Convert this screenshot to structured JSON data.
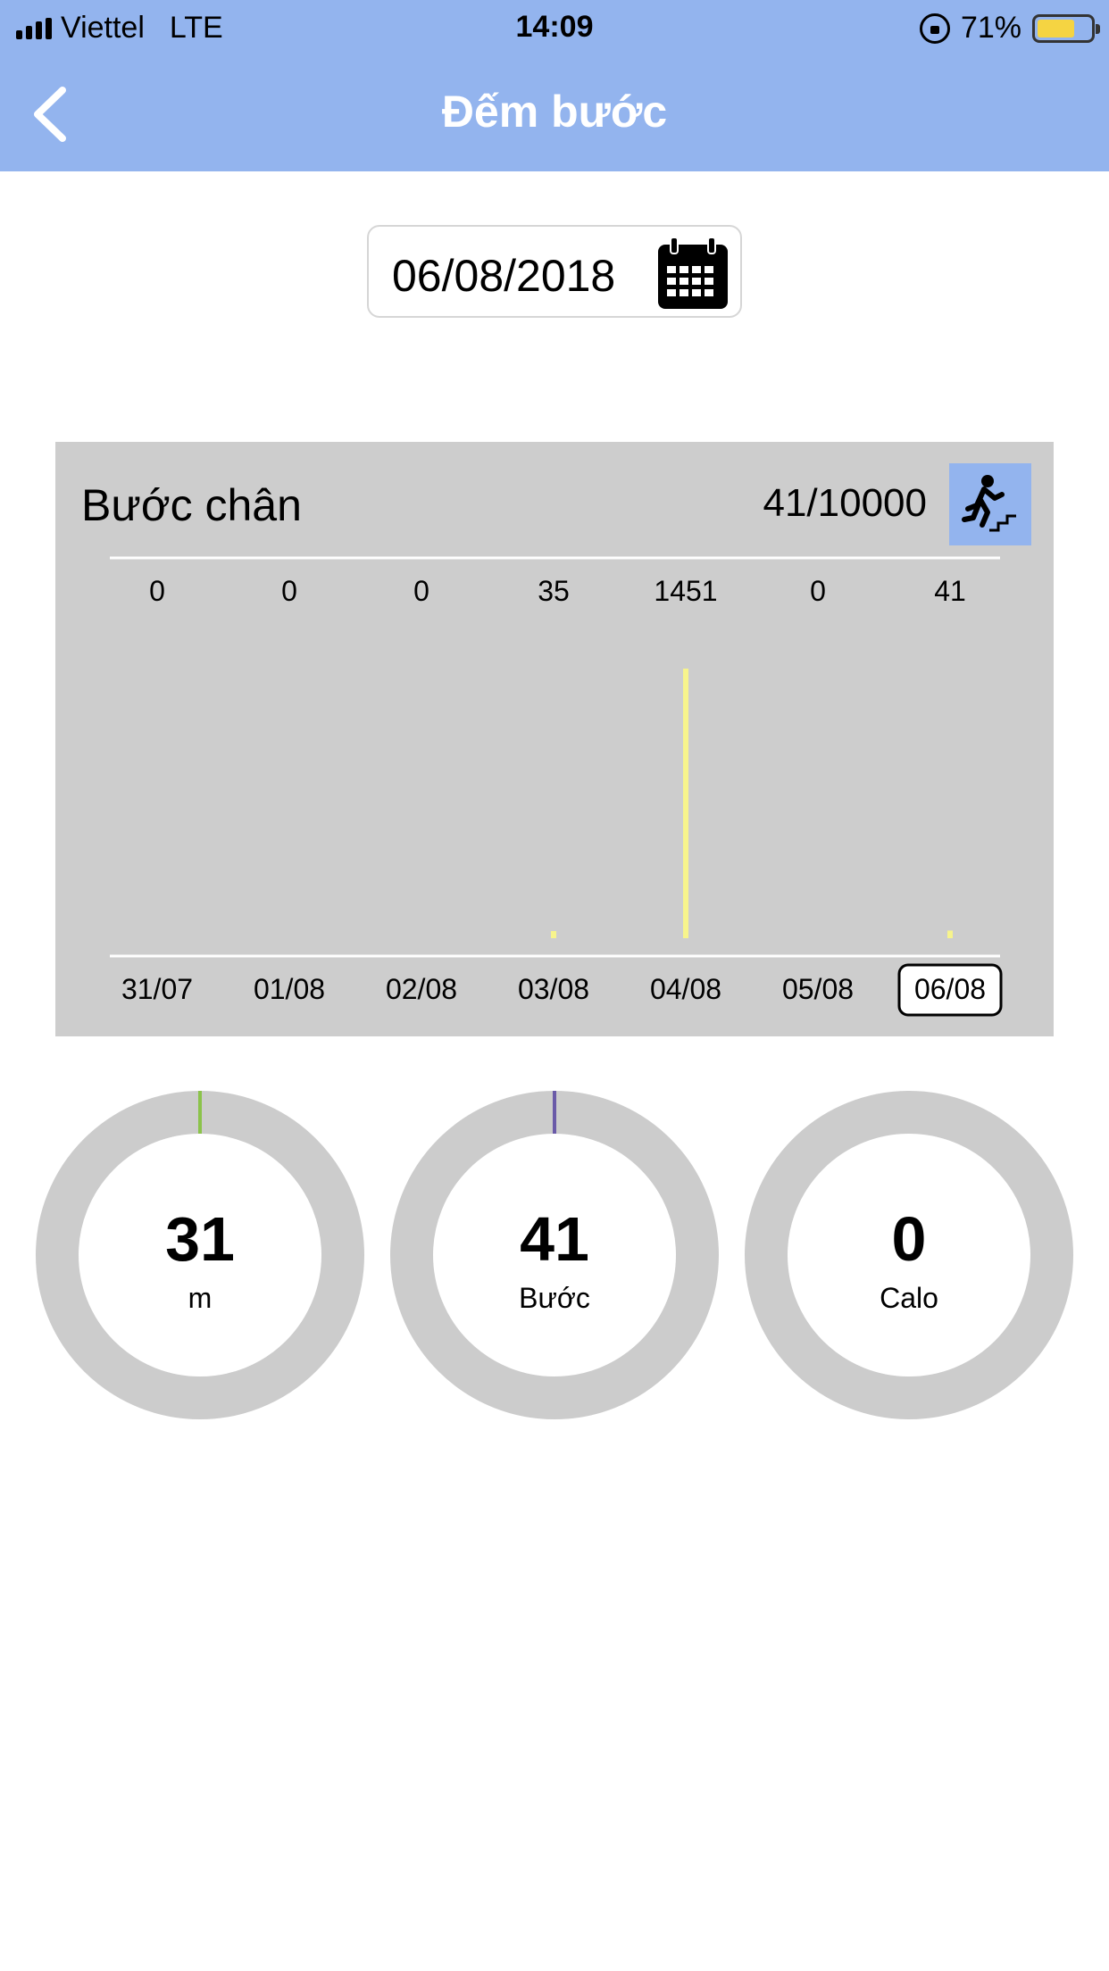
{
  "status_bar": {
    "carrier": "Viettel",
    "network": "LTE",
    "time": "14:09",
    "battery": "71%",
    "battery_level": 0.71
  },
  "header": {
    "title": "Đếm bước",
    "back_icon": "chevron-left-icon"
  },
  "date_picker": {
    "value": "06/08/2018",
    "icon": "calendar-icon"
  },
  "steps_card": {
    "title": "Bước chân",
    "count": "41/10000",
    "icon": "running-stairs-icon",
    "icon_bg": "#93b4ee"
  },
  "chart_data": {
    "type": "bar",
    "categories": [
      "31/07",
      "01/08",
      "02/08",
      "03/08",
      "04/08",
      "05/08",
      "06/08"
    ],
    "values": [
      0,
      0,
      0,
      35,
      1451,
      0,
      41
    ],
    "value_labels": [
      "0",
      "0",
      "0",
      "35",
      "1451",
      "0",
      "41"
    ],
    "selected_category": "06/08",
    "bar_color": "#f7f48c",
    "grid": false,
    "ylim": [
      0,
      1451
    ]
  },
  "stats": [
    {
      "value": "31",
      "unit": "m",
      "accent": "#8bc34a",
      "progress": 0.0
    },
    {
      "value": "41",
      "unit": "Bước",
      "accent": "#6a5aa8",
      "progress": 0.0
    },
    {
      "value": "0",
      "unit": "Calo",
      "accent": "#cccccc",
      "progress": 0.0
    }
  ]
}
